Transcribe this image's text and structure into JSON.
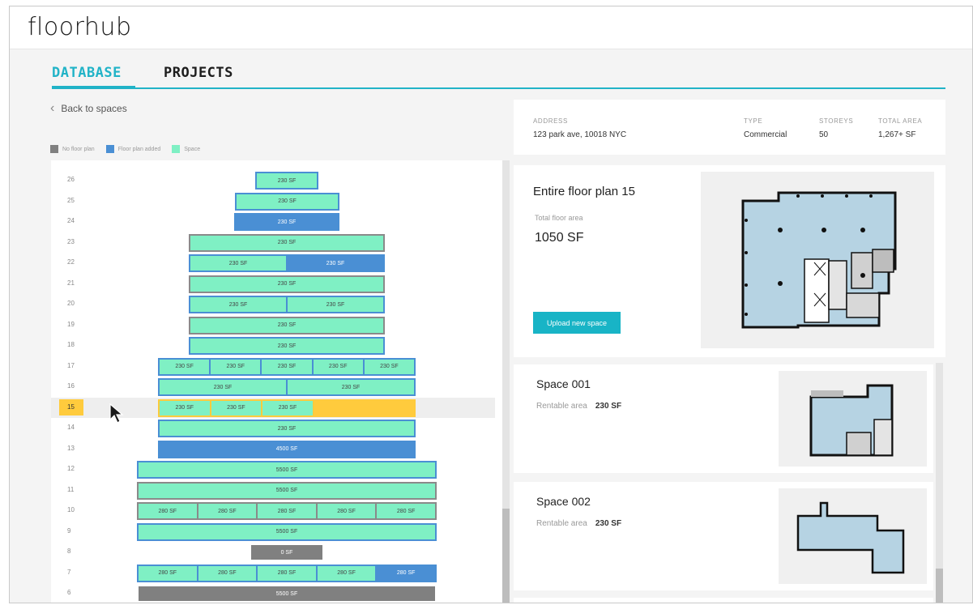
{
  "app": {
    "logo": "floorhub"
  },
  "tabs": [
    {
      "label": "DATABASE",
      "active": true
    },
    {
      "label": "PROJECTS",
      "active": false
    }
  ],
  "back_link": "Back to spaces",
  "legend": [
    {
      "label": "No floor plan",
      "color": "#808080"
    },
    {
      "label": "Floor plan added",
      "color": "#4a8fd4"
    },
    {
      "label": "Space",
      "color": "#7ff0c4"
    }
  ],
  "floors": [
    {
      "label": "26",
      "border": "blue",
      "segments": [
        {
          "text": "230 SF",
          "type": "space"
        }
      ]
    },
    {
      "label": "25",
      "border": "blue",
      "segments": [
        {
          "text": "230 SF",
          "type": "space"
        }
      ]
    },
    {
      "label": "24",
      "border": "blue",
      "segments": [
        {
          "text": "230 SF",
          "type": "plan"
        }
      ]
    },
    {
      "label": "23",
      "border": "gray",
      "segments": [
        {
          "text": "230 SF",
          "type": "space"
        }
      ]
    },
    {
      "label": "22",
      "border": "blue",
      "segments": [
        {
          "text": "230 SF",
          "type": "space"
        },
        {
          "text": "230 SF",
          "type": "plan"
        }
      ]
    },
    {
      "label": "21",
      "border": "gray",
      "segments": [
        {
          "text": "230 SF",
          "type": "space"
        }
      ]
    },
    {
      "label": "20",
      "border": "blue",
      "segments": [
        {
          "text": "230 SF",
          "type": "space"
        },
        {
          "text": "230 SF",
          "type": "space"
        }
      ]
    },
    {
      "label": "19",
      "border": "gray",
      "segments": [
        {
          "text": "230 SF",
          "type": "space"
        }
      ]
    },
    {
      "label": "18",
      "border": "blue",
      "segments": [
        {
          "text": "230 SF",
          "type": "space"
        }
      ]
    },
    {
      "label": "17",
      "border": "blue",
      "segments": [
        {
          "text": "230 SF",
          "type": "space"
        },
        {
          "text": "230 SF",
          "type": "space"
        },
        {
          "text": "230 SF",
          "type": "space"
        },
        {
          "text": "230 SF",
          "type": "space"
        },
        {
          "text": "230 SF",
          "type": "space"
        }
      ]
    },
    {
      "label": "16",
      "border": "blue",
      "segments": [
        {
          "text": "230 SF",
          "type": "space"
        },
        {
          "text": "230 SF",
          "type": "space"
        }
      ]
    },
    {
      "label": "15",
      "border": "yellow",
      "selected": true,
      "segments": [
        {
          "text": "230 SF",
          "type": "space"
        },
        {
          "text": "230 SF",
          "type": "space"
        },
        {
          "text": "230 SF",
          "type": "space"
        },
        {
          "text": "",
          "type": "empty",
          "flex": 2
        }
      ]
    },
    {
      "label": "14",
      "border": "blue",
      "segments": [
        {
          "text": "230 SF",
          "type": "space"
        }
      ]
    },
    {
      "label": "13",
      "border": "blue",
      "segments": [
        {
          "text": "4500 SF",
          "type": "plan"
        }
      ]
    },
    {
      "label": "12",
      "border": "blue",
      "segments": [
        {
          "text": "5500 SF",
          "type": "space"
        }
      ]
    },
    {
      "label": "11",
      "border": "gray",
      "segments": [
        {
          "text": "5500 SF",
          "type": "space"
        }
      ]
    },
    {
      "label": "10",
      "border": "gray",
      "segments": [
        {
          "text": "280 SF",
          "type": "space"
        },
        {
          "text": "280 SF",
          "type": "space"
        },
        {
          "text": "280 SF",
          "type": "space"
        },
        {
          "text": "280 SF",
          "type": "space"
        },
        {
          "text": "280 SF",
          "type": "space"
        }
      ]
    },
    {
      "label": "9",
      "border": "blue",
      "segments": [
        {
          "text": "5500 SF",
          "type": "space"
        }
      ]
    },
    {
      "label": "8",
      "border": "none",
      "segments": [
        {
          "text": "0 SF",
          "type": "none"
        }
      ]
    },
    {
      "label": "7",
      "border": "blue",
      "segments": [
        {
          "text": "280 SF",
          "type": "space"
        },
        {
          "text": "280 SF",
          "type": "space"
        },
        {
          "text": "280 SF",
          "type": "space"
        },
        {
          "text": "280 SF",
          "type": "space"
        },
        {
          "text": "280 SF",
          "type": "plan"
        }
      ]
    },
    {
      "label": "6",
      "border": "none",
      "segments": [
        {
          "text": "5500 SF",
          "type": "none"
        }
      ]
    }
  ],
  "building": {
    "address_label": "ADDRESS",
    "address": "123 park ave, 10018 NYC",
    "type_label": "TYPE",
    "type": "Commercial",
    "storeys_label": "STOREYS",
    "storeys": "50",
    "total_area_label": "TOTAL AREA",
    "total_area": "1,267+ SF"
  },
  "floor_plan": {
    "title": "Entire floor plan 15",
    "area_label": "Total floor area",
    "area": "1050 SF",
    "upload_label": "Upload new space"
  },
  "spaces": [
    {
      "title": "Space 001",
      "area_label": "Rentable area",
      "area": "230 SF"
    },
    {
      "title": "Space 002",
      "area_label": "Rentable area",
      "area": "230 SF"
    }
  ]
}
